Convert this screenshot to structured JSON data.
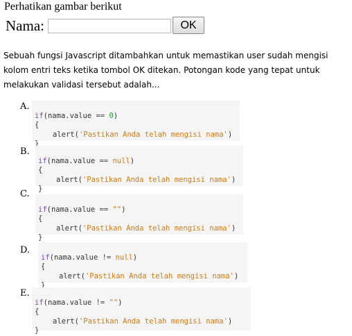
{
  "caption": "Perhatikan gambar berikut",
  "form": {
    "label": "Nama:",
    "input_value": "",
    "ok_label": "OK"
  },
  "question": "Sebuah fungsi Javascript ditambahkan untuk memastikan user sudah mengisi kolom entri teks ketika tombol OK ditekan. Potongan kode yang tepat untuk melakukan validasi tersebut adalah...",
  "options": [
    {
      "letter": "A.",
      "cond_kw": "if",
      "cond_open": "(nama.value ",
      "cond_op": "==",
      "cond_val": "0",
      "cond_close": ")",
      "open": "{",
      "stmt": "alert(",
      "msg": "'Pastikan Anda telah mengisi nama'",
      "stmt_close": ")",
      "close": "}"
    },
    {
      "letter": "B.",
      "cond_kw": "if",
      "cond_open": "(nama.value ",
      "cond_op": "==",
      "cond_val": "null",
      "cond_close": ")",
      "open": "{",
      "stmt": "alert(",
      "msg": "'Pastikan Anda telah mengisi nama'",
      "stmt_close": ")",
      "close": "}"
    },
    {
      "letter": "C.",
      "cond_kw": "if",
      "cond_open": "(nama.value ",
      "cond_op": "==",
      "cond_val": "\"\"",
      "cond_close": ")",
      "open": "{",
      "stmt": "alert(",
      "msg": "'Pastikan Anda telah mengisi nama'",
      "stmt_close": ")",
      "close": "}"
    },
    {
      "letter": "D.",
      "cond_kw": "if",
      "cond_open": "(nama.value ",
      "cond_op": "!=",
      "cond_val": "null",
      "cond_close": ")",
      "open": "{",
      "stmt": "alert(",
      "msg": "'Pastikan Anda telah mengisi nama'",
      "stmt_close": ")",
      "close": "}"
    },
    {
      "letter": "E.",
      "cond_kw": "if",
      "cond_open": "(nama.value ",
      "cond_op": "!=",
      "cond_val": "\"\"",
      "cond_close": ")",
      "open": "{",
      "stmt": "alert(",
      "msg": "'Pastikan Anda telah mengisi nama'",
      "stmt_close": ")",
      "close": "}"
    }
  ]
}
